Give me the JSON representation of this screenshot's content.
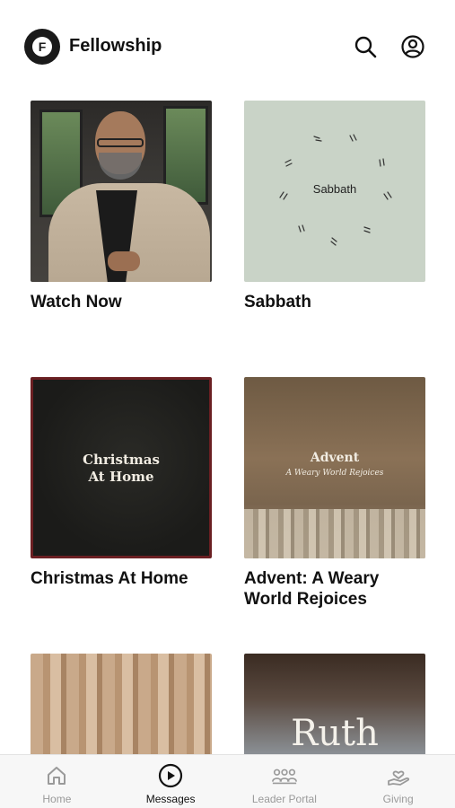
{
  "header": {
    "logo_letter": "F",
    "title": "Fellowship",
    "search_icon": "search-icon",
    "profile_icon": "profile-icon"
  },
  "cards": [
    {
      "title": "Watch Now"
    },
    {
      "title": "Sabbath",
      "thumb_text": "Sabbath"
    },
    {
      "title": "Christmas At Home",
      "thumb_line1": "Christmas",
      "thumb_line2": "At Home"
    },
    {
      "title": "Advent: A Weary World Rejoices",
      "thumb_line1": "Advent",
      "thumb_line2": "A Weary World Rejoices"
    },
    {
      "title": ""
    },
    {
      "title": "",
      "thumb_text": "Ruth"
    }
  ],
  "tabs": [
    {
      "label": "Home",
      "icon": "home-icon"
    },
    {
      "label": "Messages",
      "icon": "play-circle-icon",
      "active": true
    },
    {
      "label": "Leader Portal",
      "icon": "group-icon"
    },
    {
      "label": "Giving",
      "icon": "giving-hand-heart-icon"
    }
  ],
  "colors": {
    "accent": "#111111",
    "tab_inactive": "#9a9a9a",
    "tabbar_bg": "#f7f7f7"
  }
}
